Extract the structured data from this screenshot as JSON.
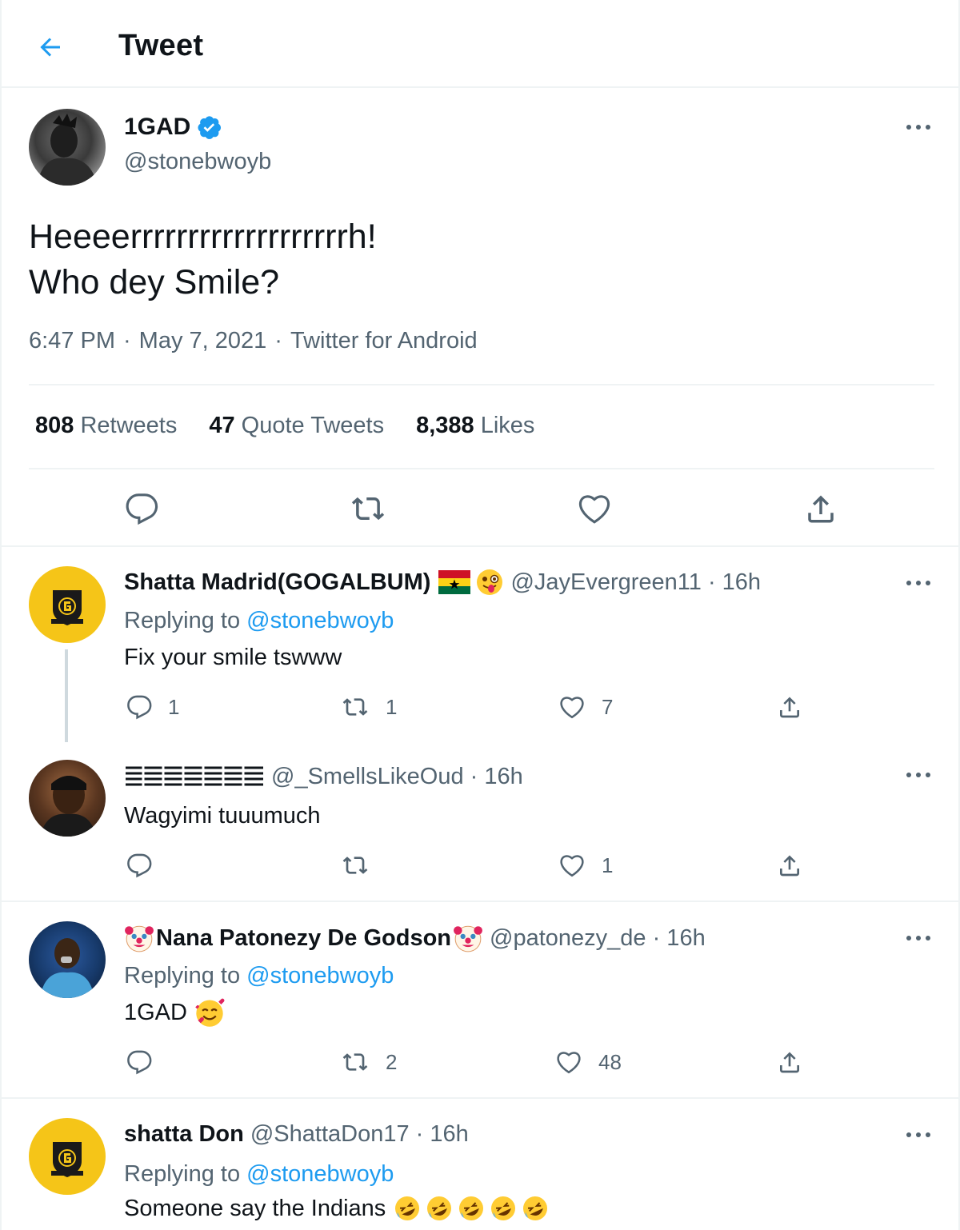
{
  "header": {
    "title": "Tweet",
    "back_icon": "arrow-left-icon"
  },
  "main_tweet": {
    "name": "1GAD",
    "handle": "@stonebwoyb",
    "verified": true,
    "text_lines": [
      "Heeeerrrrrrrrrrrrrrrrrrrh!",
      "Who dey Smile?"
    ],
    "time": "6:47 PM",
    "date": "May 7, 2021",
    "source": "Twitter for Android",
    "stats": {
      "retweets_count": "808",
      "retweets_label": "Retweets",
      "quotes_count": "47",
      "quotes_label": "Quote Tweets",
      "likes_count": "8,388",
      "likes_label": "Likes"
    }
  },
  "replies": [
    {
      "name": "Shatta Madrid(GOGALBUM)",
      "handle": "@JayEvergreen11 · 16h",
      "replying_prefix": "Replying to",
      "replying_to": "@stonebwoyb",
      "text": "Fix your smile tswww",
      "counts": {
        "reply": "1",
        "retweet": "1",
        "like": "7"
      }
    },
    {
      "name": "",
      "handle": "@_SmellsLikeOud · 16h",
      "text": "Wagyimi tuuumuch",
      "counts": {
        "reply": "",
        "retweet": "",
        "like": "1"
      }
    },
    {
      "name": "Nana Patonezy De Godson",
      "handle": "@patonezy_de · 16h",
      "replying_prefix": "Replying to",
      "replying_to": "@stonebwoyb",
      "text": "1GAD",
      "counts": {
        "reply": "",
        "retweet": "2",
        "like": "48"
      }
    },
    {
      "name": "shatta Don",
      "handle": "@ShattaDon17 · 16h",
      "replying_prefix": "Replying to",
      "replying_to": "@stonebwoyb",
      "text": "Someone say the Indians",
      "counts": {
        "reply": "",
        "retweet": "",
        "like": ""
      }
    }
  ],
  "colors": {
    "accent": "#1d9bf0",
    "secondary_text": "#536471",
    "border": "#eff3f4",
    "avatar_gold": "#f5c518"
  }
}
